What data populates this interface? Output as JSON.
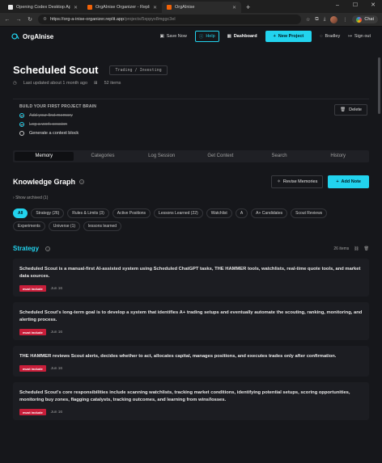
{
  "browser": {
    "tabs": [
      {
        "title": "Opening Codex Desktop App",
        "active": false,
        "color": "#e8e8e8"
      },
      {
        "title": "OrgAInise Organizer - Replit",
        "active": false,
        "color": "#f26207"
      },
      {
        "title": "OrgAInise",
        "active": true,
        "color": "#f26207"
      }
    ],
    "url_host": "https://org-a-inise-organizer.replit.app",
    "url_path": "/projects/5xppyx8mggc3el",
    "chat_label": "Chat"
  },
  "topnav": {
    "brand": "OrgAInise",
    "save_label": "Save Now",
    "help_label": "Help",
    "dashboard_label": "Dashboard",
    "new_project_label": "New Project",
    "user_label": "Bradley",
    "signout_label": "Sign out"
  },
  "project": {
    "title": "Scheduled Scout",
    "tag": "Trading / Investing",
    "updated": "Last updated about 1 month ago",
    "items": "52 items",
    "delete_label": "Delete"
  },
  "brain": {
    "title": "BUILD YOUR FIRST PROJECT BRAIN",
    "steps": [
      {
        "label": "Add your first memory",
        "done": true
      },
      {
        "label": "Log a work session",
        "done": true
      },
      {
        "label": "Generate a context block",
        "done": false
      }
    ]
  },
  "tabs": [
    "Memory",
    "Categories",
    "Log Session",
    "Get Context",
    "Search",
    "History"
  ],
  "knowledge": {
    "title": "Knowledge Graph",
    "revise_label": "Revise Memories",
    "add_label": "Add Note",
    "show_archived": "Show archived (1)"
  },
  "chips": [
    "All",
    "Strategy (26)",
    "Rules & Limits (3)",
    "Active Positions",
    "Lessons Learned (22)",
    "Watchlist",
    "A",
    "A+ Candidates",
    "Scout Reviews",
    "Experiments",
    "Universe (1)",
    "lessons learned"
  ],
  "strategy": {
    "title": "Strategy",
    "count": "26 items"
  },
  "cards": [
    {
      "text": "Scheduled Scout is a manual-first AI-assisted system using Scheduled ChatGPT tasks, THE HAMMER tools, watchlists, real-time quote tools, and market data sources.",
      "badge": "must include",
      "date": "Jun 16"
    },
    {
      "text": "Scheduled Scout's long-term goal is to develop a system that identifies A+ trading setups and eventually automate the scouting, ranking, monitoring, and alerting process.",
      "badge": "must include",
      "date": "Jun 16"
    },
    {
      "text": "THE HAMMER reviews Scout alerts, decides whether to act, allocates capital, manages positions, and executes trades only after confirmation.",
      "badge": "must include",
      "date": "Jun 16"
    },
    {
      "text": "Scheduled Scout's core responsibilities include scanning watchlists, tracking market conditions, identifying potential setups, scoring opportunities, monitoring buy zones, flagging catalysts, tracking outcomes, and learning from wins/losses.",
      "badge": "must include",
      "date": "Jun 16"
    }
  ],
  "colors": {
    "accent": "#22d3ee",
    "badge": "#c81e3a",
    "bg": "#16171b"
  }
}
